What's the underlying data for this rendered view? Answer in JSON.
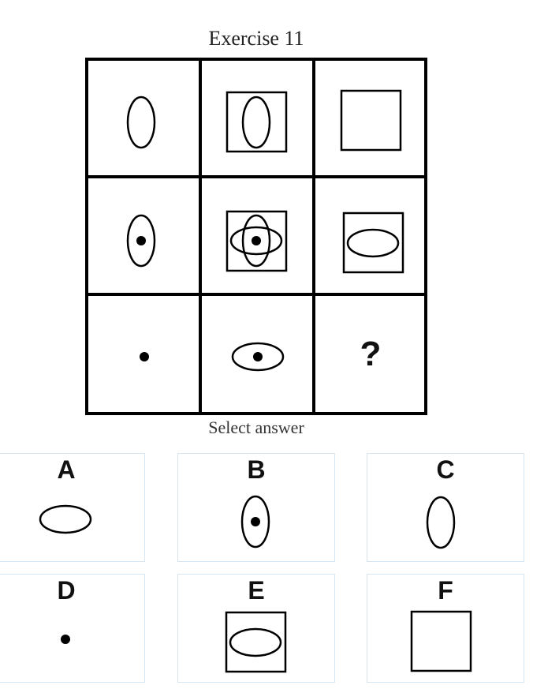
{
  "title": "Exercise 11",
  "select_label": "Select answer",
  "question_mark": "?",
  "options": [
    {
      "letter": "A"
    },
    {
      "letter": "B"
    },
    {
      "letter": "C"
    },
    {
      "letter": "D"
    },
    {
      "letter": "E"
    },
    {
      "letter": "F"
    }
  ]
}
